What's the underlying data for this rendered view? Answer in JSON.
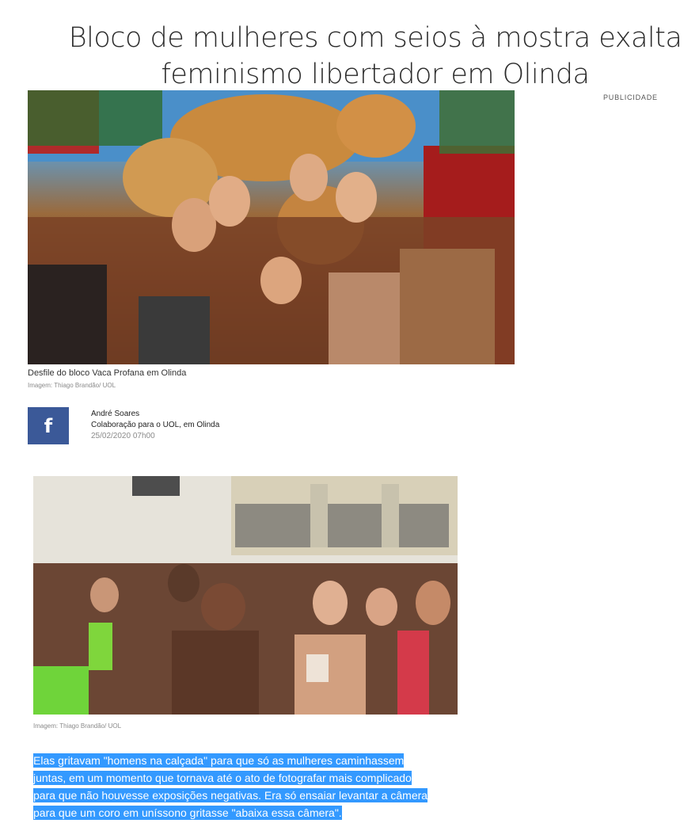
{
  "article": {
    "headline_line1": "Bloco de mulheres com seios à mostra exalta",
    "headline_line2": "feminismo libertador em Olinda",
    "ad_label": "PUBLICIDADE",
    "photo1": {
      "caption": "Desfile do bloco Vaca Profana em Olinda",
      "credit": "Imagem: Thiago Brandão/ UOL"
    },
    "share": {
      "icon": "facebook-icon",
      "glyph": "f"
    },
    "byline": {
      "author": "André Soares",
      "role": "Colaboração para o UOL, em Olinda",
      "date": "25/02/2020  07h00"
    },
    "photo2": {
      "credit": "Imagem: Thiago Brandão/ UOL"
    },
    "paragraph_lines": [
      "Elas gritavam \"homens na calçada\" para que só as mulheres caminhassem",
      "juntas, em um momento que tornava até o ato de fotografar mais complicado",
      "para que não houvesse exposições negativas. Era só ensaiar levantar a câmera",
      "para que um coro em uníssono gritasse \"abaixa essa câmera\"."
    ],
    "colors": {
      "facebook": "#3b5998",
      "selection": "#3399ff"
    }
  }
}
